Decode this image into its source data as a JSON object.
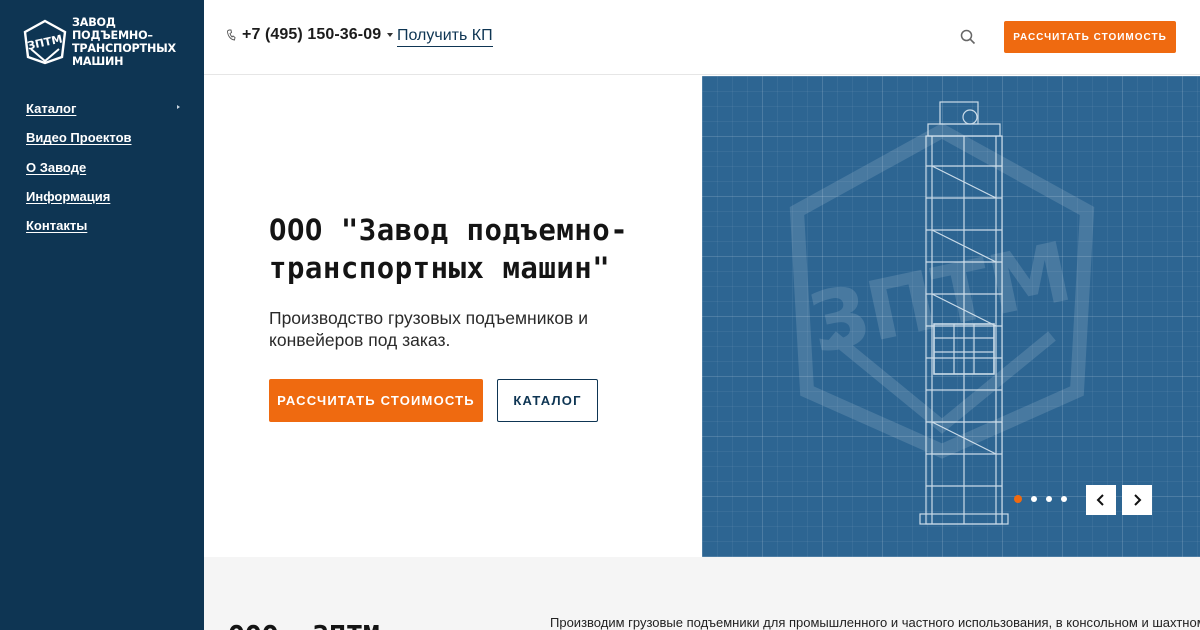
{
  "brand": {
    "logo_mark": "ЗПТМ",
    "name_line1": "ЗАВОД ПОДЪЕМНО–",
    "name_line2": "ТРАНСПОРТНЫХ МАШИН"
  },
  "sidebar": {
    "items": [
      {
        "label": "Каталог",
        "has_submenu": true
      },
      {
        "label": "Видео Проектов"
      },
      {
        "label": "О Заводе"
      },
      {
        "label": "Информация"
      },
      {
        "label": "Контакты"
      }
    ]
  },
  "header": {
    "phone_icon": "phone-icon",
    "phone": "+7 (495) 150-36-09",
    "kp_link": "Получить КП",
    "search_icon": "search-icon",
    "cta": "РАССЧИТАТЬ СТОИМОСТЬ"
  },
  "hero": {
    "title_line1": "ООО \"Завод подъемно-",
    "title_line2": "транспортных машин\"",
    "subtitle": "Производство грузовых подъемников и конвейеров под заказ.",
    "primary_button": "РАССЧИТАТЬ СТОИМОСТЬ",
    "secondary_button": "КАТАЛОГ",
    "watermark": "ЗПТМ",
    "slider": {
      "total_slides": 4,
      "active_slide": 1,
      "prev_icon": "chevron-left-icon",
      "next_icon": "chevron-right-icon"
    }
  },
  "about": {
    "title": "ООО «ЗПТМ»",
    "text": "Производим грузовые подъемники для промышленного и частного использования, в консольном и шахтном"
  },
  "colors": {
    "sidebar": "#0e3553",
    "accent": "#ef6a10",
    "blueprint": "#2d6592"
  }
}
